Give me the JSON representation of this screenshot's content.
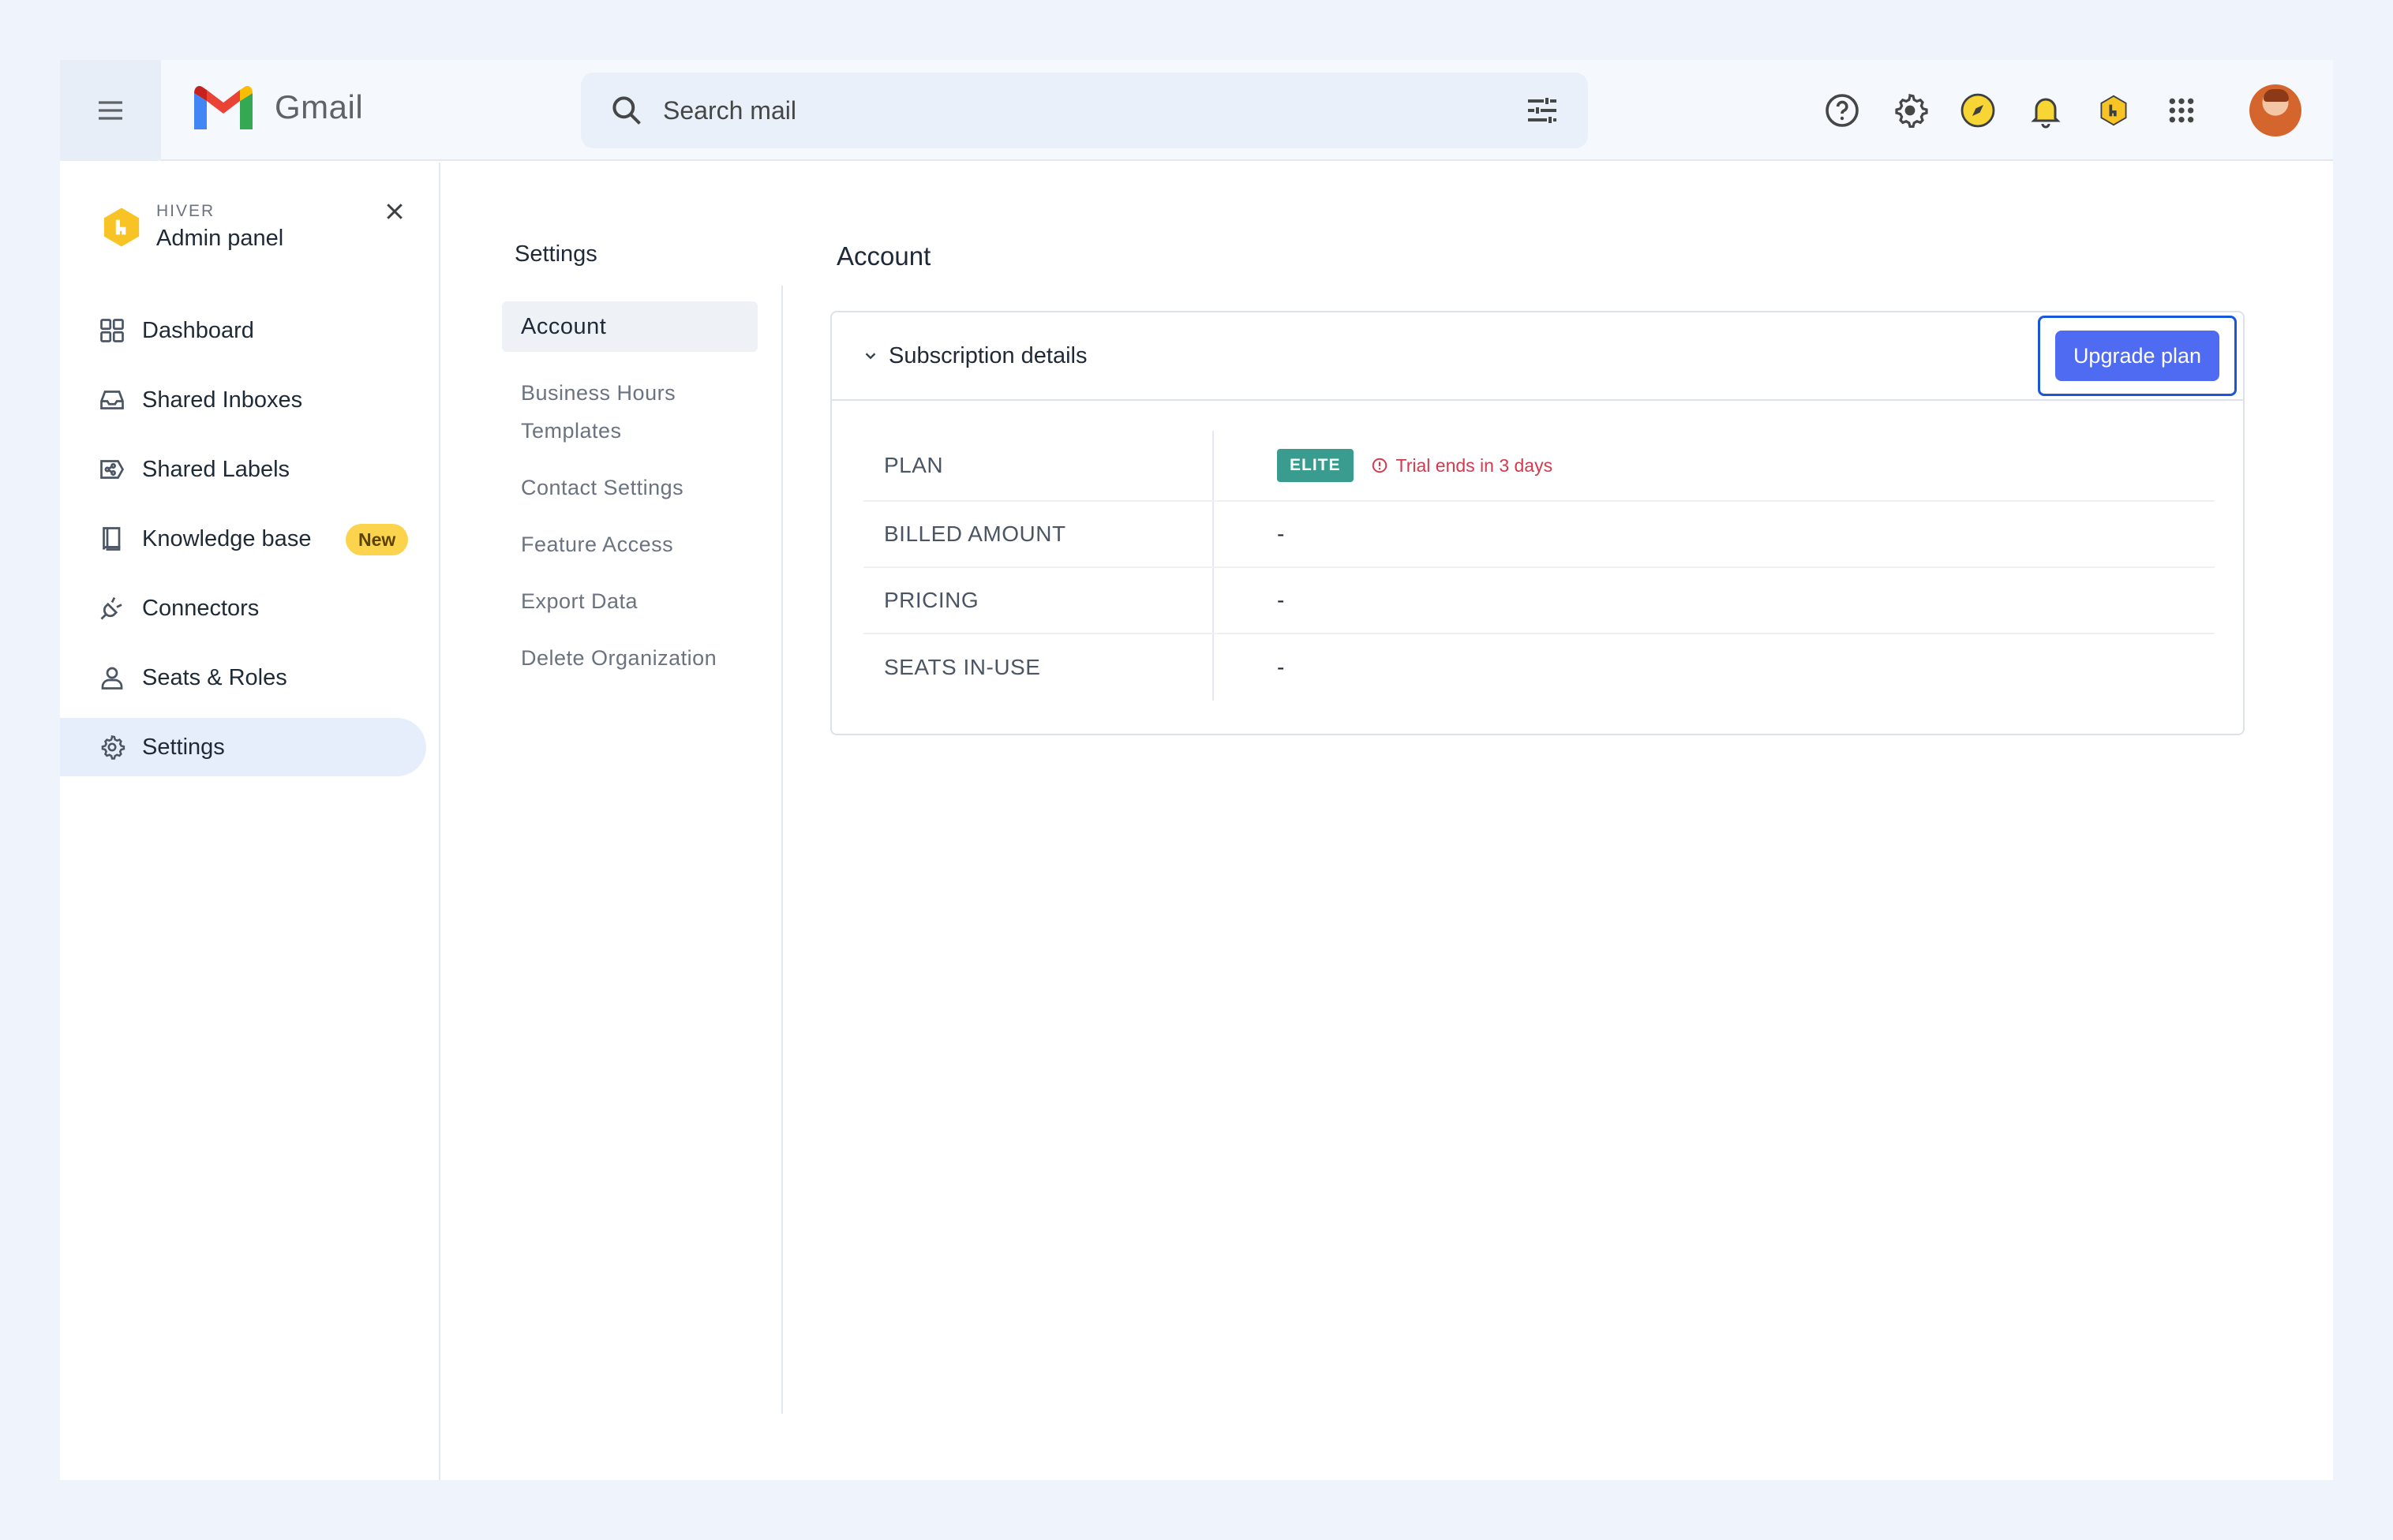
{
  "topbar": {
    "app_name": "Gmail",
    "search_placeholder": "Search mail"
  },
  "sidebar": {
    "brand_small": "HIVER",
    "brand_title": "Admin panel",
    "items": [
      {
        "label": "Dashboard",
        "icon": "dashboard-icon"
      },
      {
        "label": "Shared Inboxes",
        "icon": "inbox-icon"
      },
      {
        "label": "Shared Labels",
        "icon": "label-icon"
      },
      {
        "label": "Knowledge base",
        "icon": "book-icon",
        "badge": "New"
      },
      {
        "label": "Connectors",
        "icon": "plug-icon"
      },
      {
        "label": "Seats & Roles",
        "icon": "user-icon"
      },
      {
        "label": "Settings",
        "icon": "gear-icon",
        "active": true
      }
    ]
  },
  "subnav": {
    "title": "Settings",
    "items": [
      "Account",
      "Business Hours Templates",
      "Contact Settings",
      "Feature Access",
      "Export Data",
      "Delete Organization"
    ]
  },
  "main": {
    "title": "Account",
    "card": {
      "title": "Subscription details",
      "upgrade_label": "Upgrade plan",
      "rows": [
        {
          "key": "PLAN",
          "plan_badge": "ELITE",
          "trial_text": "Trial ends in 3 days"
        },
        {
          "key": "BILLED AMOUNT",
          "value": "-"
        },
        {
          "key": "PRICING",
          "value": "-"
        },
        {
          "key": "SEATS IN-USE",
          "value": "-"
        }
      ]
    }
  },
  "colors": {
    "accent": "#4f6bf2",
    "elite_badge": "#3a9b8f",
    "trial_warning": "#d33a4e",
    "new_badge": "#fcd34d",
    "hiver_yellow": "#f7c325"
  }
}
